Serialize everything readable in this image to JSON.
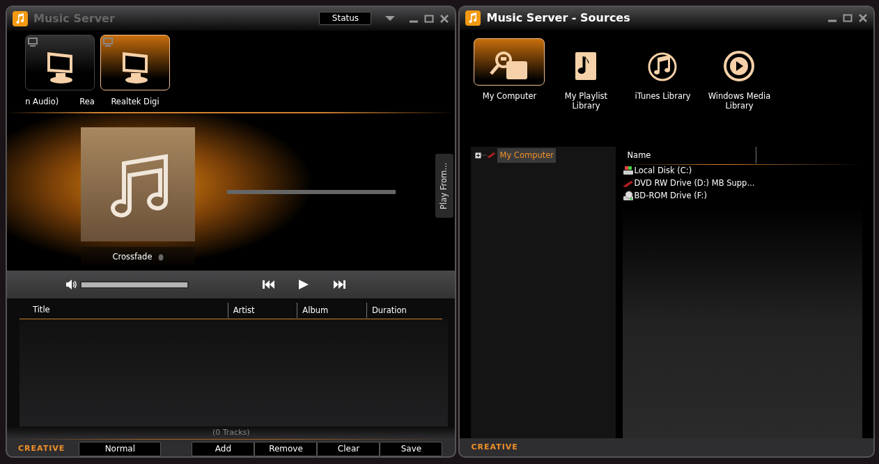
{
  "player": {
    "title": "Music Server",
    "status_button": "Status",
    "devices": [
      {
        "labels": [
          "n Audio)",
          "Rea"
        ],
        "selected": false
      },
      {
        "labels": [
          "Realtek Digi"
        ],
        "selected": true
      }
    ],
    "crossfade": "Crossfade",
    "play_from": "Play From...",
    "volume": {
      "level": 1.0
    },
    "playlist": {
      "columns": [
        "Title",
        "Artist",
        "Album",
        "Duration"
      ],
      "count": "(0 Tracks)"
    },
    "logo": "CREATIVE",
    "mode_button": "Normal",
    "buttons": [
      "Add",
      "Remove",
      "Clear",
      "Save"
    ]
  },
  "sources": {
    "title": "Music Server - Sources",
    "items": [
      {
        "label": "My Computer",
        "kind": "computer",
        "selected": true
      },
      {
        "label": "My Playlist Library",
        "kind": "playlist",
        "selected": false
      },
      {
        "label": "iTunes Library",
        "kind": "itunes",
        "selected": false
      },
      {
        "label": "Windows Media Library",
        "kind": "wmp",
        "selected": false
      }
    ],
    "tree": [
      {
        "label": "My Computer",
        "expanded": false,
        "selected": true
      }
    ],
    "columns": [
      "Name"
    ],
    "files": [
      {
        "name": "Local Disk (C:)",
        "kind": "disk"
      },
      {
        "name": "DVD RW Drive (D:) MB Supp...",
        "kind": "dvd"
      },
      {
        "name": "BD-ROM Drive (F:)",
        "kind": "bdrom"
      }
    ],
    "logo": "CREATIVE"
  }
}
